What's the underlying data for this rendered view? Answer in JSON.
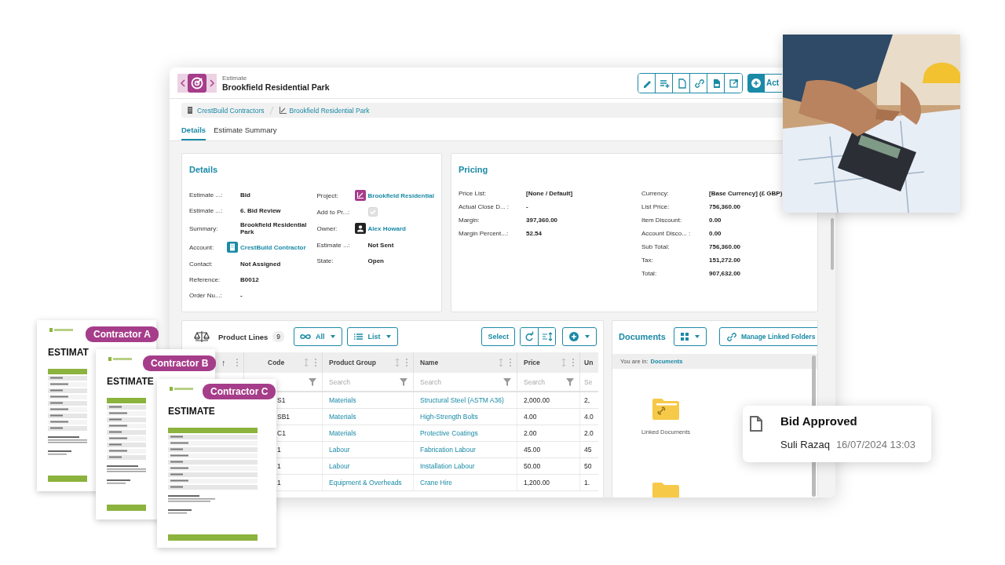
{
  "header": {
    "record_type": "Estimate",
    "title": "Brookfield Residential Park",
    "actions_button": "Act"
  },
  "breadcrumb": [
    {
      "label": "CrestBuild Contractors",
      "kind": "account"
    },
    {
      "label": "Brookfield Residential Park",
      "kind": "project"
    }
  ],
  "tabs": [
    {
      "label": "Details",
      "selected": true
    },
    {
      "label": "Estimate Summary",
      "selected": false
    }
  ],
  "details": {
    "title": "Details",
    "columns": [
      [
        {
          "label": "Estimate ...:",
          "value": "Bid",
          "kind": "text"
        },
        {
          "label": "Estimate ...:",
          "value": "6. Bid Review",
          "kind": "text"
        },
        {
          "label": "Summary:",
          "value": "Brookfield Residential Park",
          "kind": "text"
        },
        {
          "label": "Account:",
          "value": "CrestBuild Contractor",
          "kind": "account"
        },
        {
          "label": "Contact:",
          "value": "Not Assigned",
          "kind": "text"
        },
        {
          "label": "Reference:",
          "value": "B0012",
          "kind": "text"
        },
        {
          "label": "Order Nu...:",
          "value": "-",
          "kind": "text"
        }
      ],
      [
        {
          "label": "Project:",
          "value": "Brookfield Residential",
          "kind": "project"
        },
        {
          "label": "Add to Pr...:",
          "kind": "checkbox",
          "checked": true,
          "disabled": true
        },
        {
          "label": "Owner:",
          "value": "Alex Howard",
          "kind": "person"
        },
        {
          "label": "Estimate ...:",
          "value": "Not Sent",
          "kind": "text"
        },
        {
          "label": "State:",
          "value": "Open",
          "kind": "text"
        }
      ]
    ]
  },
  "pricing": {
    "title": "Pricing",
    "columns": [
      [
        {
          "label": "Price List:",
          "value": "[None / Default]"
        },
        {
          "label": "Actual Close D... :",
          "value": "-"
        },
        {
          "label": "Margin:",
          "value": "397,360.00"
        },
        {
          "label": "Margin Percent...:",
          "value": "52.54"
        }
      ],
      [
        {
          "label": "Currency:",
          "value": "[Base Currency] (£ GBP)"
        },
        {
          "label": "List Price:",
          "value": "756,360.00"
        },
        {
          "label": "Item Discount:",
          "value": "0.00"
        },
        {
          "label": "Account Disco... :",
          "value": "0.00"
        },
        {
          "label": "Sub Total:",
          "value": "756,360.00"
        },
        {
          "label": "Tax:",
          "value": "151,272.00"
        },
        {
          "label": "Total:",
          "value": "907,632.00"
        }
      ]
    ]
  },
  "product_lines": {
    "title": "Product Lines",
    "count": "9",
    "filter_button": "All",
    "view_button": "List",
    "select_button": "Select",
    "table": {
      "columns": [
        {
          "kind": "sort",
          "sort_arrow": "↑"
        },
        {
          "kind": "text",
          "label": "Code"
        },
        {
          "kind": "text",
          "label": "Product Group"
        },
        {
          "kind": "text",
          "label": "Name"
        },
        {
          "kind": "text",
          "label": "Price"
        },
        {
          "kind": "cut",
          "label": "Un"
        }
      ],
      "filters": [
        {
          "kind": "empty"
        },
        {
          "kind": "funnel"
        },
        {
          "kind": "search",
          "placeholder": "Search"
        },
        {
          "kind": "search",
          "placeholder": "Search"
        },
        {
          "kind": "search",
          "placeholder": "Search"
        },
        {
          "kind": "cut",
          "placeholder": "Se"
        }
      ],
      "rows": [
        [
          "",
          "S1",
          "Materials",
          "Structural Steel (ASTM A36)",
          "2,000.00",
          "2,"
        ],
        [
          "",
          "SB1",
          "Materials",
          "High-Strength Bolts",
          "4.00",
          "4.0"
        ],
        [
          "",
          "C1",
          "Materials",
          "Protective Coatings",
          "2.00",
          "2.0"
        ],
        [
          "",
          "1",
          "Labour",
          "Fabrication Labour",
          "45.00",
          "45"
        ],
        [
          "",
          "1",
          "Labour",
          "Installation Labour",
          "50.00",
          "50"
        ],
        [
          "",
          "1",
          "Equipment & Overheads",
          "Crane Hire",
          "1,200.00",
          "1."
        ]
      ]
    }
  },
  "documents": {
    "title": "Documents",
    "manage_button": "Manage Linked Folders",
    "location_label": "You are in:",
    "location": "Documents",
    "folders": [
      {
        "kind": "named",
        "name": "Linked Documents"
      },
      {
        "kind": "cut"
      }
    ]
  },
  "notification": {
    "title": "Bid Approved",
    "author": "Suli Razaq",
    "time": "16/07/2024 13:03"
  },
  "estimate_documents": [
    {
      "label": "Contractor A",
      "heading": "ESTIMAT"
    },
    {
      "label": "Contractor B",
      "heading": "ESTIMATE"
    },
    {
      "label": "Contractor C",
      "heading": "ESTIMATE"
    }
  ]
}
